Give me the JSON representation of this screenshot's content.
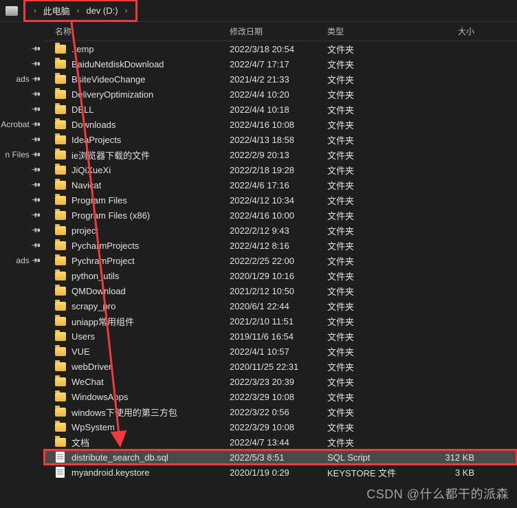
{
  "breadcrumb": {
    "part1": "此电脑",
    "part2": "dev (D:)"
  },
  "columns": {
    "name": "名称",
    "date": "修改日期",
    "type": "类型",
    "size": "大小"
  },
  "sidebar": {
    "pins": [
      "",
      "",
      "ads",
      "",
      "",
      "Acrobat",
      "",
      "n Files",
      "",
      "",
      "",
      "",
      "",
      "",
      "ads"
    ]
  },
  "rows": [
    {
      "icon": "folder",
      "name": ".temp",
      "date": "2022/3/18 20:54",
      "type": "文件夹",
      "size": ""
    },
    {
      "icon": "folder",
      "name": "BaiduNetdiskDownload",
      "date": "2022/4/7 17:17",
      "type": "文件夹",
      "size": ""
    },
    {
      "icon": "folder",
      "name": "BsiteVideoChange",
      "date": "2021/4/2 21:33",
      "type": "文件夹",
      "size": ""
    },
    {
      "icon": "folder",
      "name": "DeliveryOptimization",
      "date": "2022/4/4 10:20",
      "type": "文件夹",
      "size": ""
    },
    {
      "icon": "folder",
      "name": "DELL",
      "date": "2022/4/4 10:18",
      "type": "文件夹",
      "size": ""
    },
    {
      "icon": "folder",
      "name": "Downloads",
      "date": "2022/4/16 10:08",
      "type": "文件夹",
      "size": ""
    },
    {
      "icon": "folder",
      "name": "IdeaProjects",
      "date": "2022/4/13 18:58",
      "type": "文件夹",
      "size": ""
    },
    {
      "icon": "folder",
      "name": "ie浏览器下载的文件",
      "date": "2022/2/9 20:13",
      "type": "文件夹",
      "size": ""
    },
    {
      "icon": "folder",
      "name": "JiQiXueXi",
      "date": "2022/2/18 19:28",
      "type": "文件夹",
      "size": ""
    },
    {
      "icon": "folder",
      "name": "Navicat",
      "date": "2022/4/6 17:16",
      "type": "文件夹",
      "size": ""
    },
    {
      "icon": "folder",
      "name": "Program Files",
      "date": "2022/4/12 10:34",
      "type": "文件夹",
      "size": ""
    },
    {
      "icon": "folder",
      "name": "Program Files (x86)",
      "date": "2022/4/16 10:00",
      "type": "文件夹",
      "size": ""
    },
    {
      "icon": "folder",
      "name": "project",
      "date": "2022/2/12 9:43",
      "type": "文件夹",
      "size": ""
    },
    {
      "icon": "folder",
      "name": "PycharmProjects",
      "date": "2022/4/12 8:16",
      "type": "文件夹",
      "size": ""
    },
    {
      "icon": "folder",
      "name": "PychramProject",
      "date": "2022/2/25 22:00",
      "type": "文件夹",
      "size": ""
    },
    {
      "icon": "folder",
      "name": "python_utils",
      "date": "2020/1/29 10:16",
      "type": "文件夹",
      "size": ""
    },
    {
      "icon": "folder",
      "name": "QMDownload",
      "date": "2021/2/12 10:50",
      "type": "文件夹",
      "size": ""
    },
    {
      "icon": "folder",
      "name": "scrapy_pro",
      "date": "2020/6/1 22:44",
      "type": "文件夹",
      "size": ""
    },
    {
      "icon": "folder",
      "name": "uniapp常用组件",
      "date": "2021/2/10 11:51",
      "type": "文件夹",
      "size": ""
    },
    {
      "icon": "folder",
      "name": "Users",
      "date": "2019/11/6 16:54",
      "type": "文件夹",
      "size": ""
    },
    {
      "icon": "folder",
      "name": "VUE",
      "date": "2022/4/1 10:57",
      "type": "文件夹",
      "size": ""
    },
    {
      "icon": "folder",
      "name": "webDriver",
      "date": "2020/11/25 22:31",
      "type": "文件夹",
      "size": ""
    },
    {
      "icon": "folder",
      "name": "WeChat",
      "date": "2022/3/23 20:39",
      "type": "文件夹",
      "size": ""
    },
    {
      "icon": "folder",
      "name": "WindowsApps",
      "date": "2022/3/29 10:08",
      "type": "文件夹",
      "size": ""
    },
    {
      "icon": "folder",
      "name": "windows下使用的第三方包",
      "date": "2022/3/22 0:56",
      "type": "文件夹",
      "size": ""
    },
    {
      "icon": "folder",
      "name": "WpSystem",
      "date": "2022/3/29 10:08",
      "type": "文件夹",
      "size": ""
    },
    {
      "icon": "folder",
      "name": "文档",
      "date": "2022/4/7 13:44",
      "type": "文件夹",
      "size": ""
    },
    {
      "icon": "file",
      "name": "distribute_search_db.sql",
      "date": "2022/5/3 8:51",
      "type": "SQL Script",
      "size": "312 KB",
      "selected": true,
      "highlighted": true
    },
    {
      "icon": "file",
      "name": "myandroid.keystore",
      "date": "2020/1/19 0:29",
      "type": "KEYSTORE 文件",
      "size": "3 KB"
    }
  ],
  "watermark": "CSDN @什么都干的派森"
}
